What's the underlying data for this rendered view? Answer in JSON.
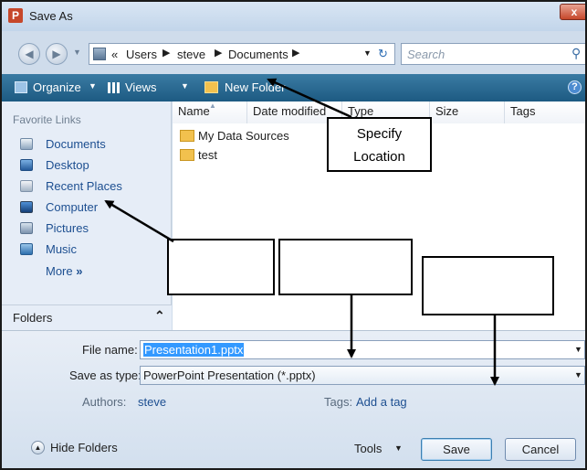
{
  "window": {
    "title": "Save As",
    "app_icon": "P",
    "close_glyph": "x"
  },
  "nav": {
    "path": [
      "«",
      "Users",
      "steve",
      "Documents"
    ],
    "search_placeholder": "Search"
  },
  "toolbar": {
    "organize": "Organize",
    "views": "Views",
    "new_folder": "New Folder"
  },
  "sidebar": {
    "heading": "Favorite Links",
    "items": [
      {
        "label": "Documents",
        "icon": "documents-icon"
      },
      {
        "label": "Desktop",
        "icon": "desktop-icon"
      },
      {
        "label": "Recent Places",
        "icon": "recent-places-icon"
      },
      {
        "label": "Computer",
        "icon": "computer-icon"
      },
      {
        "label": "Pictures",
        "icon": "pictures-icon"
      },
      {
        "label": "Music",
        "icon": "music-icon"
      }
    ],
    "more": "More",
    "folders_label": "Folders"
  },
  "filelist": {
    "columns": [
      "Name",
      "Date modified",
      "Type",
      "Size",
      "Tags"
    ],
    "files": [
      {
        "name": "My Data Sources",
        "icon": "data-sources-icon"
      },
      {
        "name": "test",
        "icon": "folder-icon"
      }
    ]
  },
  "form": {
    "filename_label": "File name:",
    "filename_value": "Presentation1.pptx",
    "savetype_label": "Save as type:",
    "savetype_value": "PowerPoint Presentation (*.pptx)",
    "authors_label": "Authors:",
    "authors_value": "steve",
    "tags_label": "Tags:",
    "tags_value": "Add a tag"
  },
  "footer": {
    "hide_folders": "Hide Folders",
    "tools": "Tools",
    "save": "Save",
    "cancel": "Cancel"
  },
  "annotation": {
    "callout_line1": "Specify",
    "callout_line2": "Location"
  },
  "colors": {
    "toolbar": "#1d5a82",
    "link": "#1d4f91",
    "selection": "#3399ff",
    "close": "#c6472a"
  }
}
